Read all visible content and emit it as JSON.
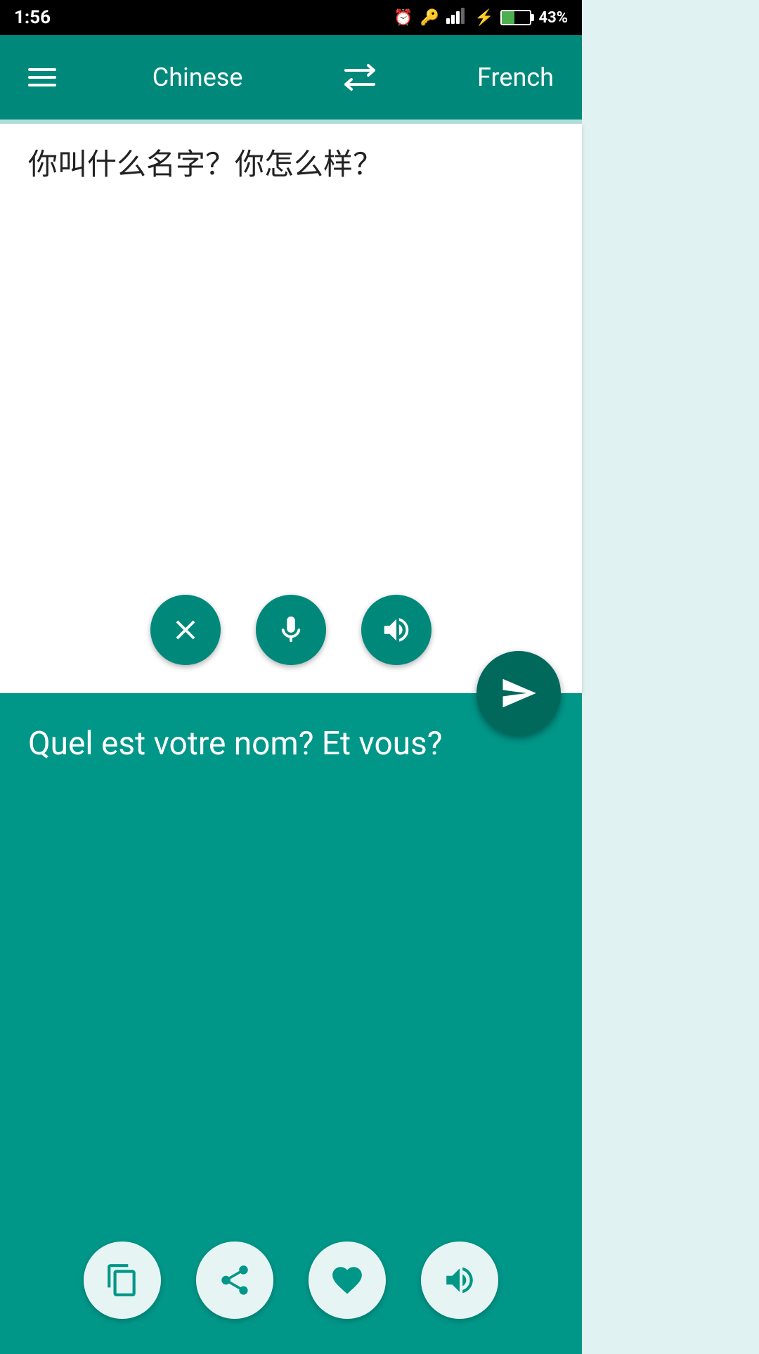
{
  "statusBar": {
    "time": "1:56",
    "battery": "43%"
  },
  "toolbar": {
    "menu_label": "menu",
    "source_lang": "Chinese",
    "swap_label": "swap languages",
    "target_lang": "French"
  },
  "inputPanel": {
    "text": "你叫什么名字？你怎么样？",
    "clear_label": "clear",
    "mic_label": "microphone",
    "speaker_label": "speak",
    "send_label": "translate"
  },
  "outputPanel": {
    "text": "Quel est votre nom? Et vous?",
    "copy_label": "copy",
    "share_label": "share",
    "favorite_label": "favorite",
    "speaker_label": "speak"
  }
}
